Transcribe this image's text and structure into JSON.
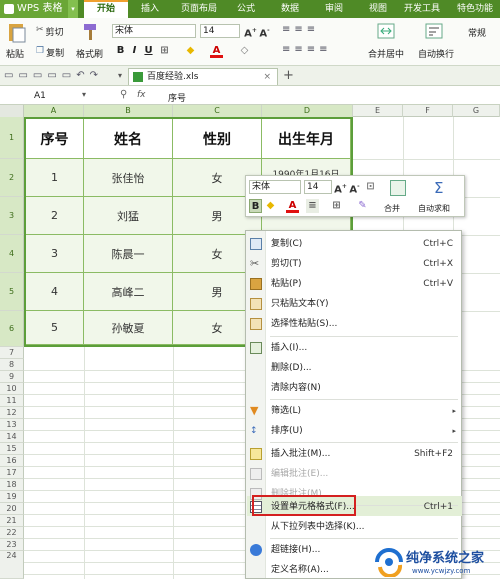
{
  "app": {
    "name": "WPS 表格"
  },
  "menu_tabs": [
    "开始",
    "插入",
    "页面布局",
    "公式",
    "数据",
    "审阅",
    "视图",
    "开发工具",
    "特色功能"
  ],
  "ribbon": {
    "paste": "粘贴",
    "cut": "剪切",
    "copy": "复制",
    "format_painter": "格式刷",
    "font_name": "宋体",
    "font_size": "14",
    "bold": "B",
    "italic": "I",
    "underline": "U",
    "merge_center": "合并居中",
    "wrap_text": "自动换行",
    "number_format": "常规"
  },
  "document": {
    "tab_label": "百度经验.xls"
  },
  "formula_bar": {
    "cell_ref": "A1",
    "fx": "fx",
    "content": "序号"
  },
  "columns": [
    "A",
    "B",
    "C",
    "D",
    "E",
    "F",
    "G"
  ],
  "rows": [
    "1",
    "2",
    "3",
    "4",
    "5",
    "6",
    "7",
    "8",
    "9",
    "10",
    "11",
    "12",
    "13",
    "14",
    "15",
    "16",
    "17",
    "18",
    "19",
    "20",
    "21",
    "22",
    "23",
    "24"
  ],
  "table": {
    "headers": [
      "序号",
      "姓名",
      "性别",
      "出生年月"
    ],
    "rows": [
      [
        "1",
        "张佳怡",
        "女",
        "1990年1月16日"
      ],
      [
        "2",
        "刘猛",
        "男",
        ""
      ],
      [
        "3",
        "陈晨一",
        "女",
        ""
      ],
      [
        "4",
        "高峰二",
        "男",
        ""
      ],
      [
        "5",
        "孙敏夏",
        "女",
        ""
      ]
    ]
  },
  "mini_toolbar": {
    "font_name": "宋体",
    "font_size": "14",
    "bold": "B",
    "merge": "合并",
    "autosum": "自动求和"
  },
  "context_menu": {
    "items": [
      {
        "label": "复制(C)",
        "shortcut": "Ctrl+C",
        "icon": "copy-icon"
      },
      {
        "label": "剪切(T)",
        "shortcut": "Ctrl+X",
        "icon": "scissors-icon"
      },
      {
        "label": "粘贴(P)",
        "shortcut": "Ctrl+V",
        "icon": "paste-icon"
      },
      {
        "label": "只粘贴文本(Y)",
        "shortcut": "",
        "icon": "paste-text-icon"
      },
      {
        "label": "选择性粘贴(S)...",
        "shortcut": "",
        "icon": "paste-special-icon"
      },
      {
        "label": "插入(I)...",
        "shortcut": "",
        "icon": "insert-icon"
      },
      {
        "label": "删除(D)...",
        "shortcut": "",
        "icon": ""
      },
      {
        "label": "清除内容(N)",
        "shortcut": "",
        "icon": ""
      },
      {
        "label": "筛选(L)",
        "shortcut": "",
        "icon": "filter-icon"
      },
      {
        "label": "排序(U)",
        "shortcut": "",
        "icon": "sort-icon"
      },
      {
        "label": "插入批注(M)...",
        "shortcut": "Shift+F2",
        "icon": "comment-icon"
      },
      {
        "label": "编辑批注(E)...",
        "shortcut": "",
        "icon": "edit-comment-icon"
      },
      {
        "label": "删除批注(M)",
        "shortcut": "",
        "icon": "delete-comment-icon"
      },
      {
        "label": "设置单元格格式(F)...",
        "shortcut": "Ctrl+1",
        "icon": "format-cells-icon"
      },
      {
        "label": "从下拉列表中选择(K)...",
        "shortcut": "",
        "icon": ""
      },
      {
        "label": "超链接(H)...",
        "shortcut": "",
        "icon": "hyperlink-icon"
      },
      {
        "label": "定义名称(A)...",
        "shortcut": "",
        "icon": ""
      }
    ]
  },
  "watermark": {
    "title": "纯净系统之家",
    "url": "www.ycwjzy.com"
  },
  "colors": {
    "brand_green": "#4f8a26",
    "table_border": "#5c9e3a",
    "highlight": "#e3efd7",
    "red_box": "#d42020"
  }
}
